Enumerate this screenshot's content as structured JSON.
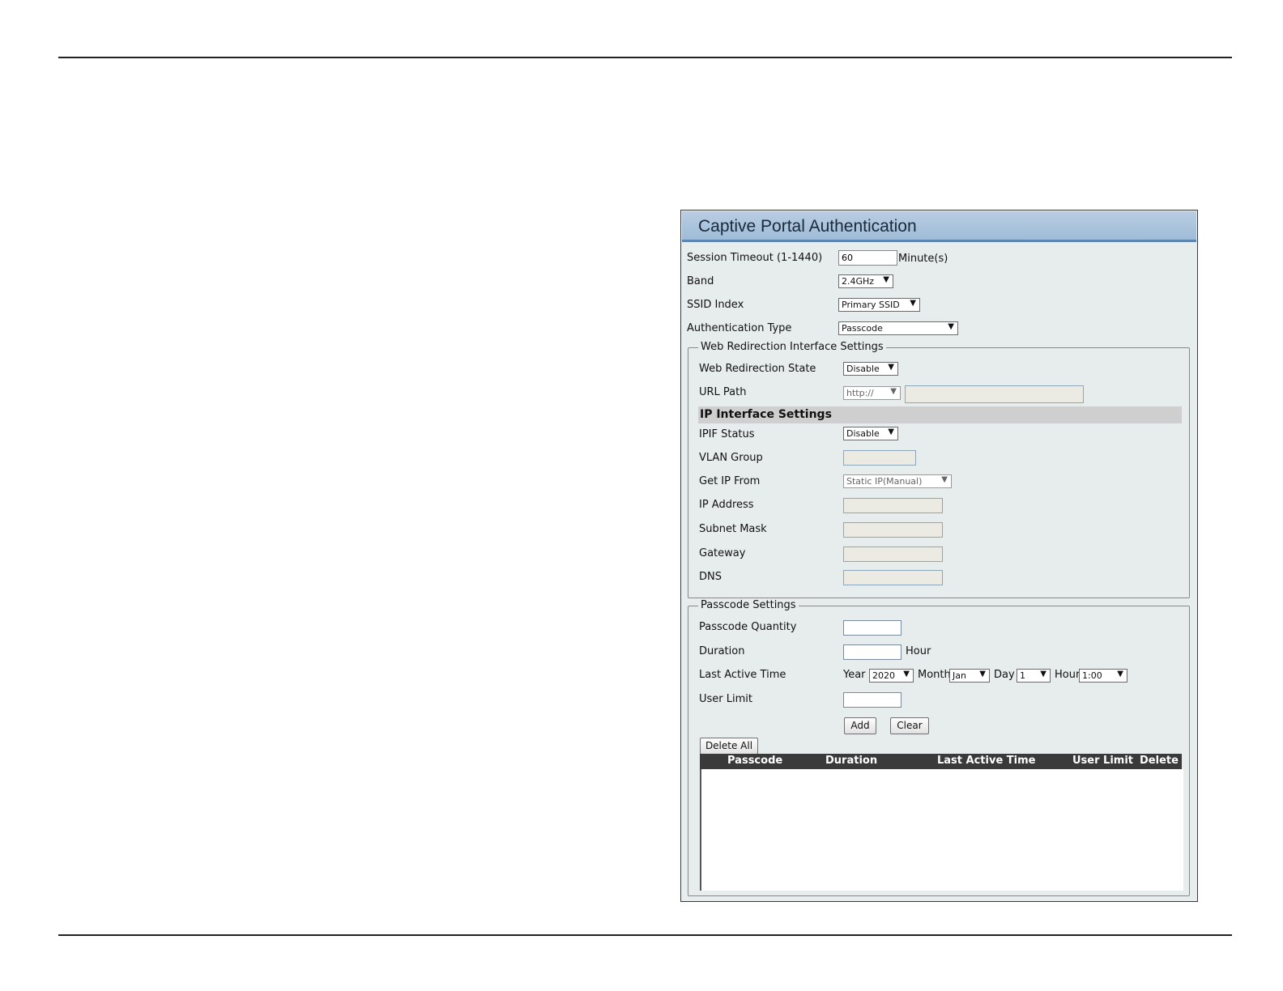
{
  "panel": {
    "title": "Captive Portal Authentication"
  },
  "general": {
    "session_timeout_label": "Session Timeout (1-1440)",
    "session_timeout_value": "60",
    "session_timeout_unit": "Minute(s)",
    "band_label": "Band",
    "band_value": "2.4GHz",
    "ssid_index_label": "SSID Index",
    "ssid_index_value": "Primary SSID",
    "auth_type_label": "Authentication Type",
    "auth_type_value": "Passcode"
  },
  "web_redirection": {
    "legend": "Web Redirection Interface Settings",
    "state_label": "Web Redirection State",
    "state_value": "Disable",
    "url_path_label": "URL Path",
    "url_scheme_value": "http://",
    "url_value": ""
  },
  "ip_interface": {
    "heading": "IP Interface Settings",
    "ipif_status_label": "IPIF Status",
    "ipif_status_value": "Disable",
    "vlan_group_label": "VLAN Group",
    "get_ip_from_label": "Get IP From",
    "get_ip_from_value": "Static IP(Manual)",
    "ip_address_label": "IP Address",
    "subnet_mask_label": "Subnet Mask",
    "gateway_label": "Gateway",
    "dns_label": "DNS"
  },
  "passcode": {
    "legend": "Passcode Settings",
    "quantity_label": "Passcode Quantity",
    "duration_label": "Duration",
    "duration_unit": "Hour",
    "last_active_label": "Last Active Time",
    "year_label": "Year",
    "year_value": "2020",
    "month_label": "Month",
    "month_value": "Jan",
    "day_label": "Day",
    "day_value": "1",
    "hour_label": "Hour",
    "hour_value": "1:00",
    "user_limit_label": "User Limit",
    "add_label": "Add",
    "clear_label": "Clear",
    "delete_all_label": "Delete All"
  },
  "table": {
    "columns": [
      "Passcode",
      "Duration",
      "Last Active Time",
      "User Limit",
      "Delete"
    ]
  },
  "icons": {
    "dropdown": "chevron-down-icon"
  }
}
